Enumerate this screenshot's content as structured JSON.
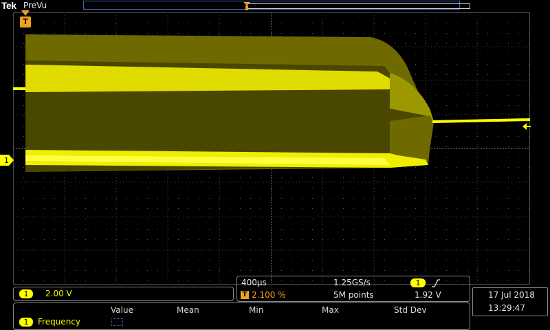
{
  "header": {
    "brand": "Tek",
    "acq_status": "PreVu"
  },
  "channel": {
    "badge": "1",
    "scale": "2.00 V",
    "color": "#ffff00"
  },
  "acquisition": {
    "timebase": "400µs",
    "sample_rate": "1.25GS/s",
    "trigger_icon": "T",
    "trigger_position": "2.100 %",
    "record_length": "5M points",
    "trigger_source_badge": "1",
    "trigger_slope_icon": "rising-edge-icon",
    "trigger_level": "1.92 V"
  },
  "datetime": {
    "date": "17 Jul  2018",
    "time": "13:29:47"
  },
  "measurements": {
    "headers": [
      "Value",
      "Mean",
      "Min",
      "Max",
      "Std Dev"
    ],
    "rows": [
      {
        "badge": "1",
        "name": "Frequency"
      }
    ]
  },
  "markers": {
    "trigger_marker": "T",
    "channel_marker": "1"
  }
}
